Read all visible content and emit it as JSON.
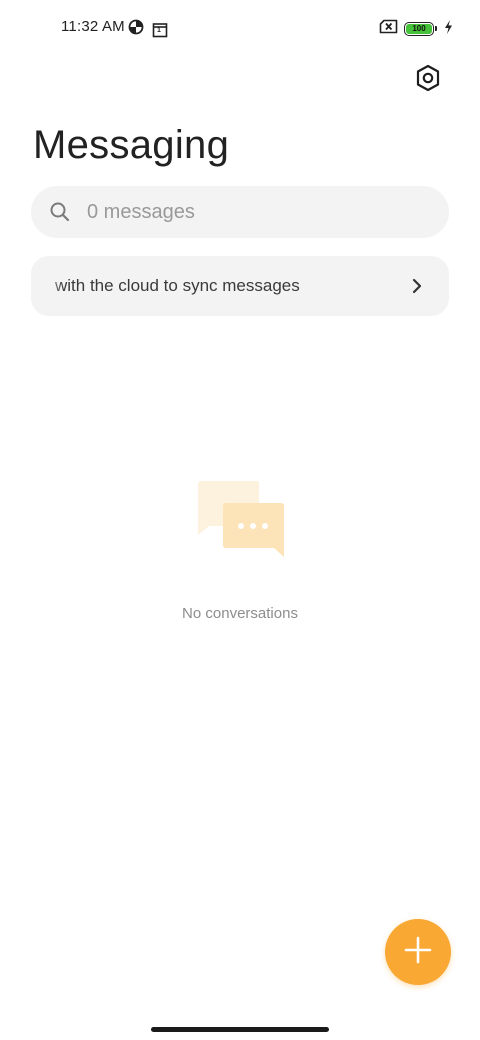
{
  "status_bar": {
    "time": "11:32 AM",
    "left_icons": [
      "data-saver-icon",
      "calendar-icon"
    ],
    "calendar_day": "1",
    "right_icons": [
      "no-sim-icon",
      "battery-icon",
      "charging-icon"
    ],
    "battery_level": "100"
  },
  "header": {
    "title": "Messaging",
    "settings_icon": "settings-icon"
  },
  "search": {
    "placeholder": "0 messages",
    "icon": "search-icon"
  },
  "sync_banner": {
    "label": "with the cloud to sync messages",
    "icon": "chevron-right-icon"
  },
  "empty_state": {
    "icon": "chat-bubbles-icon",
    "message": "No conversations"
  },
  "fab": {
    "icon": "plus-icon",
    "color": "#f8a833"
  },
  "colors": {
    "accent": "#f8a833",
    "battery": "#46c23a",
    "surface": "#f3f3f3"
  }
}
